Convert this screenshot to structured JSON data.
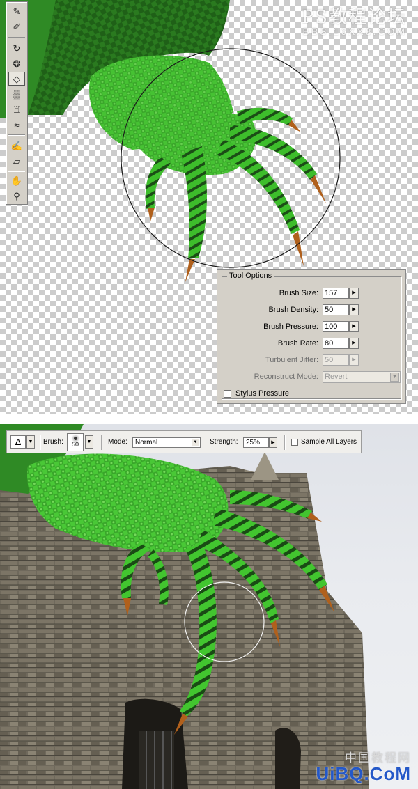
{
  "watermark_top": {
    "line1": "PS教程论坛",
    "line2": "BBS.16XX8.COM"
  },
  "toolbox": {
    "tools": [
      {
        "icon": "forward-warp-icon"
      },
      {
        "icon": "reconstruct-icon"
      },
      {
        "icon": "twirl-icon"
      },
      {
        "icon": "pucker-icon"
      },
      {
        "icon": "bloat-icon",
        "active": true
      },
      {
        "icon": "push-left-icon"
      },
      {
        "icon": "mirror-icon"
      },
      {
        "icon": "turbulence-icon"
      },
      {
        "icon": "freeze-mask-icon"
      },
      {
        "icon": "thaw-mask-icon"
      },
      {
        "icon": "hand-icon"
      },
      {
        "icon": "zoom-icon"
      }
    ]
  },
  "tool_options": {
    "title": "Tool Options",
    "brush_size": {
      "label": "Brush Size:",
      "value": "157"
    },
    "brush_density": {
      "label": "Brush Density:",
      "value": "50"
    },
    "brush_pressure": {
      "label": "Brush Pressure:",
      "value": "100"
    },
    "brush_rate": {
      "label": "Brush Rate:",
      "value": "80"
    },
    "turbulent_jitter": {
      "label": "Turbulent Jitter:",
      "value": "50",
      "disabled": true
    },
    "reconstruct_mode": {
      "label": "Reconstruct Mode:",
      "value": "Revert",
      "disabled": true
    },
    "stylus_pressure": {
      "label": "Stylus Pressure",
      "checked": false
    }
  },
  "options_bar": {
    "brush_label": "Brush:",
    "brush_size": "50",
    "mode_label": "Mode:",
    "mode_value": "Normal",
    "strength_label": "Strength:",
    "strength_value": "25%",
    "sample_all_layers": {
      "label": "Sample All Layers",
      "checked": false
    }
  },
  "watermark_bottom": {
    "line1": "中国教程网",
    "line2": "UiBQ.CoM"
  },
  "colors": {
    "lizard_green": "#3fbf2e",
    "lizard_dark": "#1d5a18",
    "claw": "#b0601c",
    "stone": "#6b6558",
    "panel_gray": "#d4d0c8"
  }
}
